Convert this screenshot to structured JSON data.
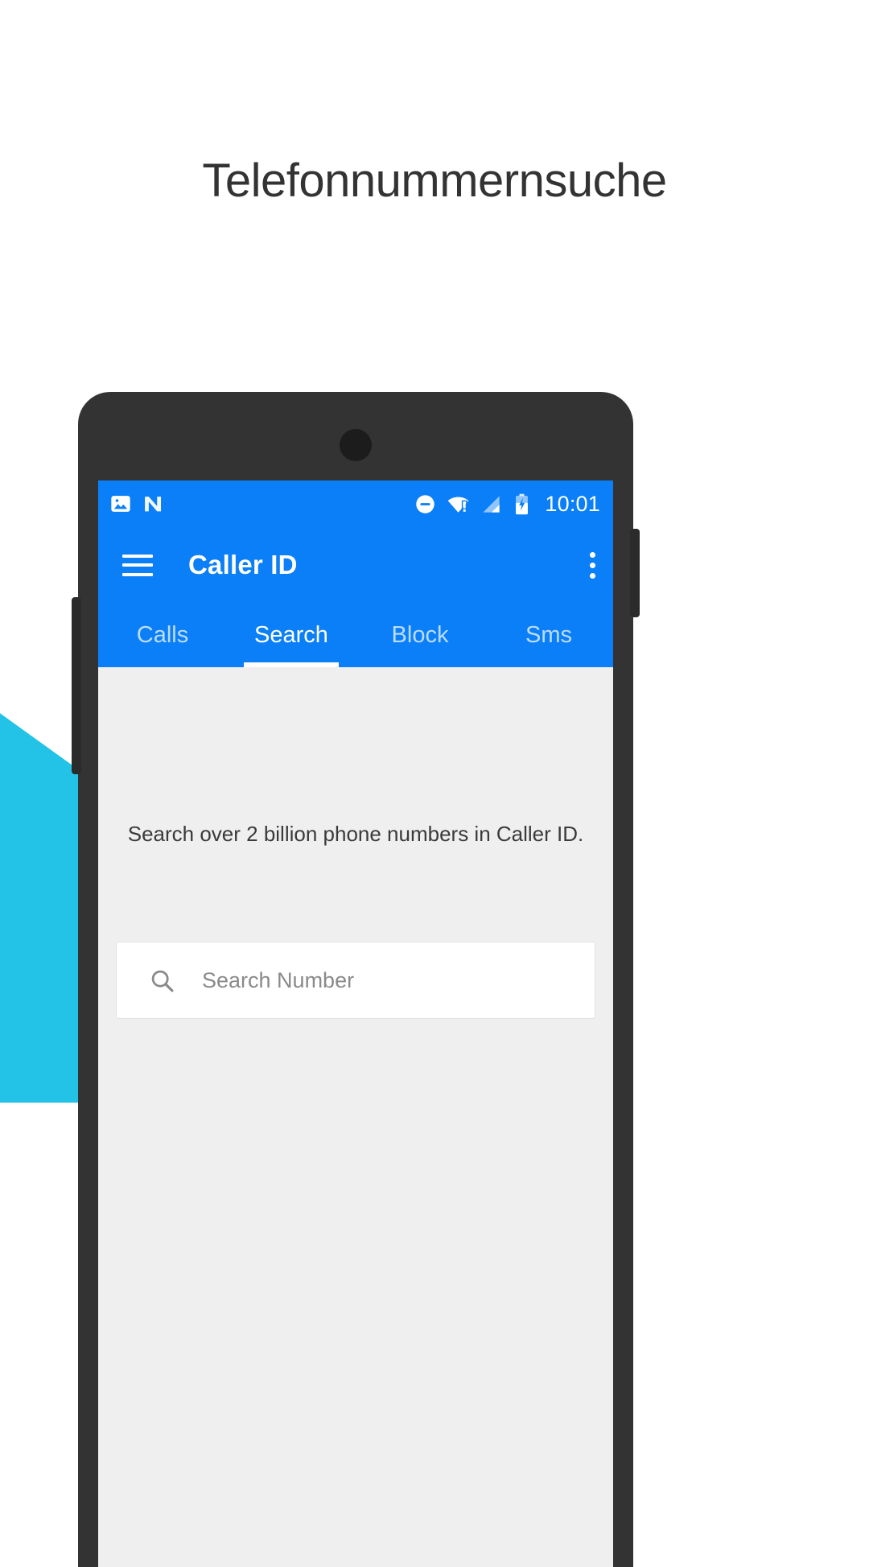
{
  "page": {
    "headline": "Telefonnummernsuche",
    "background_color": "#ffffff",
    "accent_color": "#22c3e6"
  },
  "phone": {
    "bezel_color": "#333333",
    "screen_background": "#efefef"
  },
  "statusbar": {
    "background_color": "#0b7ff7",
    "time": "10:01",
    "left_icons": [
      {
        "name": "image-icon"
      },
      {
        "name": "android-n-logo-icon"
      }
    ],
    "right_icons": [
      {
        "name": "do-not-disturb-icon"
      },
      {
        "name": "wifi-warning-icon"
      },
      {
        "name": "cellular-signal-icon"
      },
      {
        "name": "battery-charging-icon"
      }
    ]
  },
  "appbar": {
    "background_color": "#0b7ff7",
    "menu_icon": "hamburger-menu-icon",
    "title": "Caller ID",
    "overflow_icon": "more-vertical-icon"
  },
  "tabs": {
    "active_index": 1,
    "items": [
      {
        "label": "Calls"
      },
      {
        "label": "Search"
      },
      {
        "label": "Block"
      },
      {
        "label": "Sms"
      }
    ]
  },
  "content": {
    "blurb": "Search over 2 billion phone numbers in Caller ID.",
    "search": {
      "icon": "search-icon",
      "placeholder": "Search Number",
      "value": ""
    }
  }
}
